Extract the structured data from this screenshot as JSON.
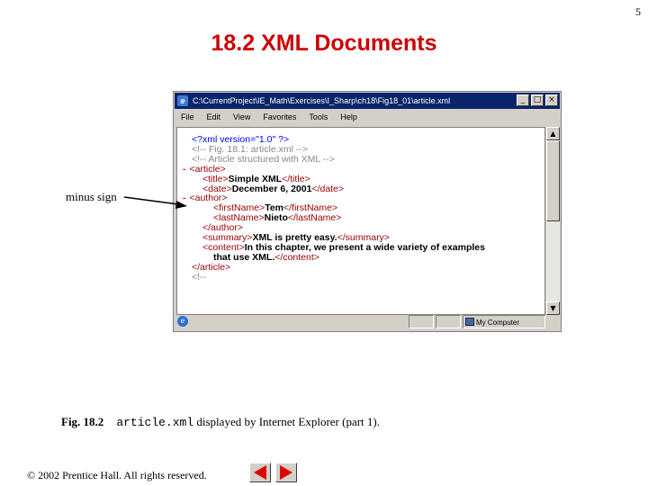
{
  "slide": {
    "page_number": "5",
    "title": "18.2  XML Documents"
  },
  "browser": {
    "title": "C:\\CurrentProject\\IE_Math\\Exercises\\I_Sharp\\ch18\\Fig18_01\\article.xml",
    "menu": [
      "File",
      "Edit",
      "View",
      "Favorites",
      "Tools",
      "Help"
    ],
    "window_buttons": {
      "minimize": "_",
      "maximize": "□",
      "close": "×"
    },
    "xml_lines": [
      {
        "indent": 0,
        "parts": [
          {
            "t": "<?xml version=\"1.0\" ?>",
            "c": "pi"
          }
        ]
      },
      {
        "indent": 0,
        "parts": [
          {
            "t": "<!-- Fig. 18.1: article.xml",
            "c": "cmt"
          },
          {
            "t": "               -->",
            "c": "cmt"
          }
        ]
      },
      {
        "indent": 0,
        "parts": [
          {
            "t": "<!-- Article structured with XML",
            "c": "cmt"
          },
          {
            "t": "       -->",
            "c": "cmt"
          }
        ]
      },
      {
        "indent": 0,
        "minus": "-",
        "parts": [
          {
            "t": "<article>",
            "c": "tag"
          }
        ]
      },
      {
        "indent": 1,
        "parts": [
          {
            "t": "<title>",
            "c": "tag"
          },
          {
            "t": "Simple XML",
            "c": "bold"
          },
          {
            "t": "</title>",
            "c": "tag"
          }
        ]
      },
      {
        "indent": 1,
        "parts": [
          {
            "t": "<date>",
            "c": "tag"
          },
          {
            "t": "December 6, 2001",
            "c": "bold"
          },
          {
            "t": "</date>",
            "c": "tag"
          }
        ]
      },
      {
        "indent": 0,
        "minus": "-",
        "parts": [
          {
            "t": "<author>",
            "c": "tag"
          }
        ]
      },
      {
        "indent": 2,
        "parts": [
          {
            "t": "<firstName>",
            "c": "tag"
          },
          {
            "t": "Tem",
            "c": "bold"
          },
          {
            "t": "</firstName>",
            "c": "tag"
          }
        ]
      },
      {
        "indent": 2,
        "parts": [
          {
            "t": "<lastName>",
            "c": "tag"
          },
          {
            "t": "Nieto",
            "c": "bold"
          },
          {
            "t": "</lastName>",
            "c": "tag"
          }
        ]
      },
      {
        "indent": 1,
        "parts": [
          {
            "t": "</author>",
            "c": "tag"
          }
        ]
      },
      {
        "indent": 1,
        "parts": [
          {
            "t": "<summary>",
            "c": "tag"
          },
          {
            "t": "XML is pretty easy.",
            "c": "bold"
          },
          {
            "t": "</summary>",
            "c": "tag"
          }
        ]
      },
      {
        "indent": 1,
        "parts": [
          {
            "t": "<content>",
            "c": "tag"
          },
          {
            "t": "In this chapter, we present a wide variety of examples",
            "c": "bold"
          }
        ]
      },
      {
        "indent": 2,
        "parts": [
          {
            "t": "that use XML.",
            "c": "bold"
          },
          {
            "t": "</content>",
            "c": "tag"
          }
        ]
      },
      {
        "indent": 0,
        "parts": [
          {
            "t": "</article>",
            "c": "tag"
          }
        ]
      },
      {
        "indent": 0,
        "parts": [
          {
            "t": "<!--",
            "c": "cmt"
          }
        ]
      }
    ],
    "status_zone": "My Computer"
  },
  "annotation": {
    "label": "minus sign"
  },
  "caption": {
    "fig": "Fig. 18.2",
    "code": "article.xml",
    "text": " displayed by Internet Explorer (part 1)."
  },
  "footer": {
    "copyright": "© 2002 Prentice Hall.  All rights reserved."
  },
  "colors": {
    "title_red": "#cc0000",
    "tag_color": "#990000",
    "nav_arrow_red": "#e00000"
  }
}
